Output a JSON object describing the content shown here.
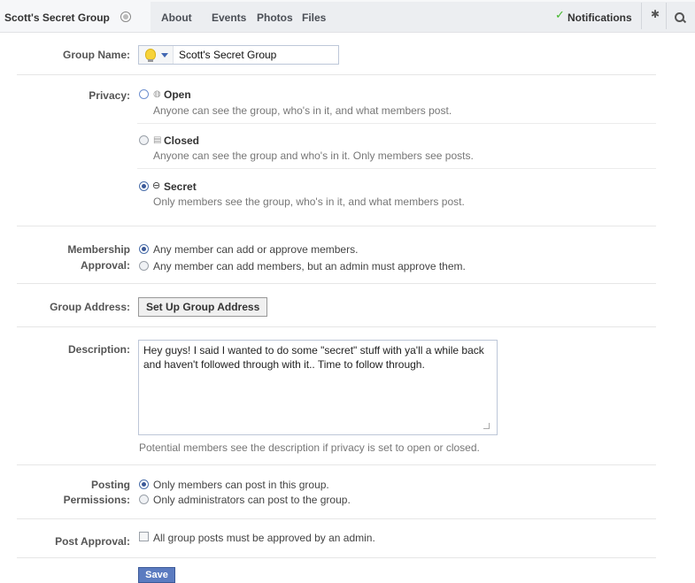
{
  "nav": {
    "group_title": "Scott's Secret Group",
    "tabs": [
      "About",
      "Events",
      "Photos",
      "Files"
    ],
    "notifications_label": "Notifications"
  },
  "form": {
    "group_name": {
      "label": "Group Name:",
      "value": "Scott's Secret Group"
    },
    "privacy": {
      "label": "Privacy:",
      "options": [
        {
          "title": "Open",
          "desc": "Anyone can see the group, who's in it, and what members post."
        },
        {
          "title": "Closed",
          "desc": "Anyone can see the group and who's in it. Only members see posts."
        },
        {
          "title": "Secret",
          "desc": "Only members see the group, who's in it, and what members post."
        }
      ],
      "selected": "Secret"
    },
    "membership": {
      "label_line1": "Membership",
      "label_line2": "Approval:",
      "options": [
        "Any member can add or approve members.",
        "Any member can add members, but an admin must approve them."
      ]
    },
    "group_address": {
      "label": "Group Address:",
      "button": "Set Up Group Address"
    },
    "description": {
      "label": "Description:",
      "value": "Hey guys! I said I wanted to do some \"secret\" stuff with ya'll a while back and haven't followed through with it.. Time to follow through.",
      "hint": "Potential members see the description if privacy is set to open or closed."
    },
    "posting": {
      "label_line1": "Posting",
      "label_line2": "Permissions:",
      "options": [
        "Only members can post in this group.",
        "Only administrators can post to the group."
      ]
    },
    "post_approval": {
      "label": "Post Approval:",
      "option": "All group posts must be approved by an admin."
    },
    "save_label": "Save"
  }
}
